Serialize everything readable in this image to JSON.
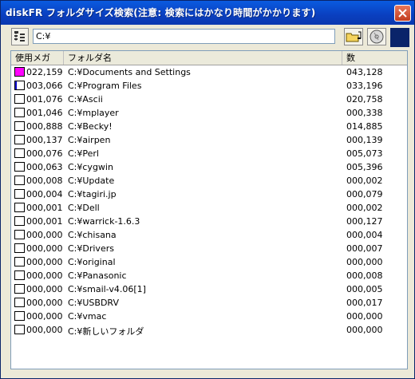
{
  "window": {
    "title": "diskFR フォルダサイズ検索(注意: 検索にはかなり時間がかかります)",
    "close_icon": "close-icon"
  },
  "toolbar": {
    "path_value": "C:¥",
    "icons": [
      "tree-list-icon",
      "open-folder-icon",
      "cd-icon",
      "moon-icon"
    ]
  },
  "columns": {
    "size": "使用メガ",
    "folder": "フォルダ名",
    "count": "数"
  },
  "colors": {
    "accent_magenta": "#ff00ff",
    "accent_blue": "#0000cc"
  },
  "rows": [
    {
      "size": "022,159",
      "name": "C:¥Documents and Settings",
      "count": "043,128",
      "fill": 1.0,
      "color": "#ff00ff"
    },
    {
      "size": "003,066",
      "name": "C:¥Program Files",
      "count": "033,196",
      "fill": 0.14,
      "color": "#0000cc"
    },
    {
      "size": "001,076",
      "name": "C:¥Ascii",
      "count": "020,758",
      "fill": 0.0
    },
    {
      "size": "001,046",
      "name": "C:¥mplayer",
      "count": "000,338",
      "fill": 0.0
    },
    {
      "size": "000,888",
      "name": "C:¥Becky!",
      "count": "014,885",
      "fill": 0.0
    },
    {
      "size": "000,137",
      "name": "C:¥airpen",
      "count": "000,139",
      "fill": 0.0
    },
    {
      "size": "000,076",
      "name": "C:¥Perl",
      "count": "005,073",
      "fill": 0.0
    },
    {
      "size": "000,063",
      "name": "C:¥cygwin",
      "count": "005,396",
      "fill": 0.0
    },
    {
      "size": "000,008",
      "name": "C:¥Update",
      "count": "000,002",
      "fill": 0.0
    },
    {
      "size": "000,004",
      "name": "C:¥tagiri.jp",
      "count": "000,079",
      "fill": 0.0
    },
    {
      "size": "000,001",
      "name": "C:¥Dell",
      "count": "000,002",
      "fill": 0.0
    },
    {
      "size": "000,001",
      "name": "C:¥warrick-1.6.3",
      "count": "000,127",
      "fill": 0.0
    },
    {
      "size": "000,000",
      "name": "C:¥chisana",
      "count": "000,004",
      "fill": 0.0
    },
    {
      "size": "000,000",
      "name": "C:¥Drivers",
      "count": "000,007",
      "fill": 0.0
    },
    {
      "size": "000,000",
      "name": "C:¥original",
      "count": "000,000",
      "fill": 0.0
    },
    {
      "size": "000,000",
      "name": "C:¥Panasonic",
      "count": "000,008",
      "fill": 0.0
    },
    {
      "size": "000,000",
      "name": "C:¥smail-v4.06[1]",
      "count": "000,005",
      "fill": 0.0
    },
    {
      "size": "000,000",
      "name": "C:¥USBDRV",
      "count": "000,017",
      "fill": 0.0
    },
    {
      "size": "000,000",
      "name": "C:¥vmac",
      "count": "000,000",
      "fill": 0.0
    },
    {
      "size": "000,000",
      "name": "C:¥新しいフォルダ",
      "count": "000,000",
      "fill": 0.0
    }
  ]
}
